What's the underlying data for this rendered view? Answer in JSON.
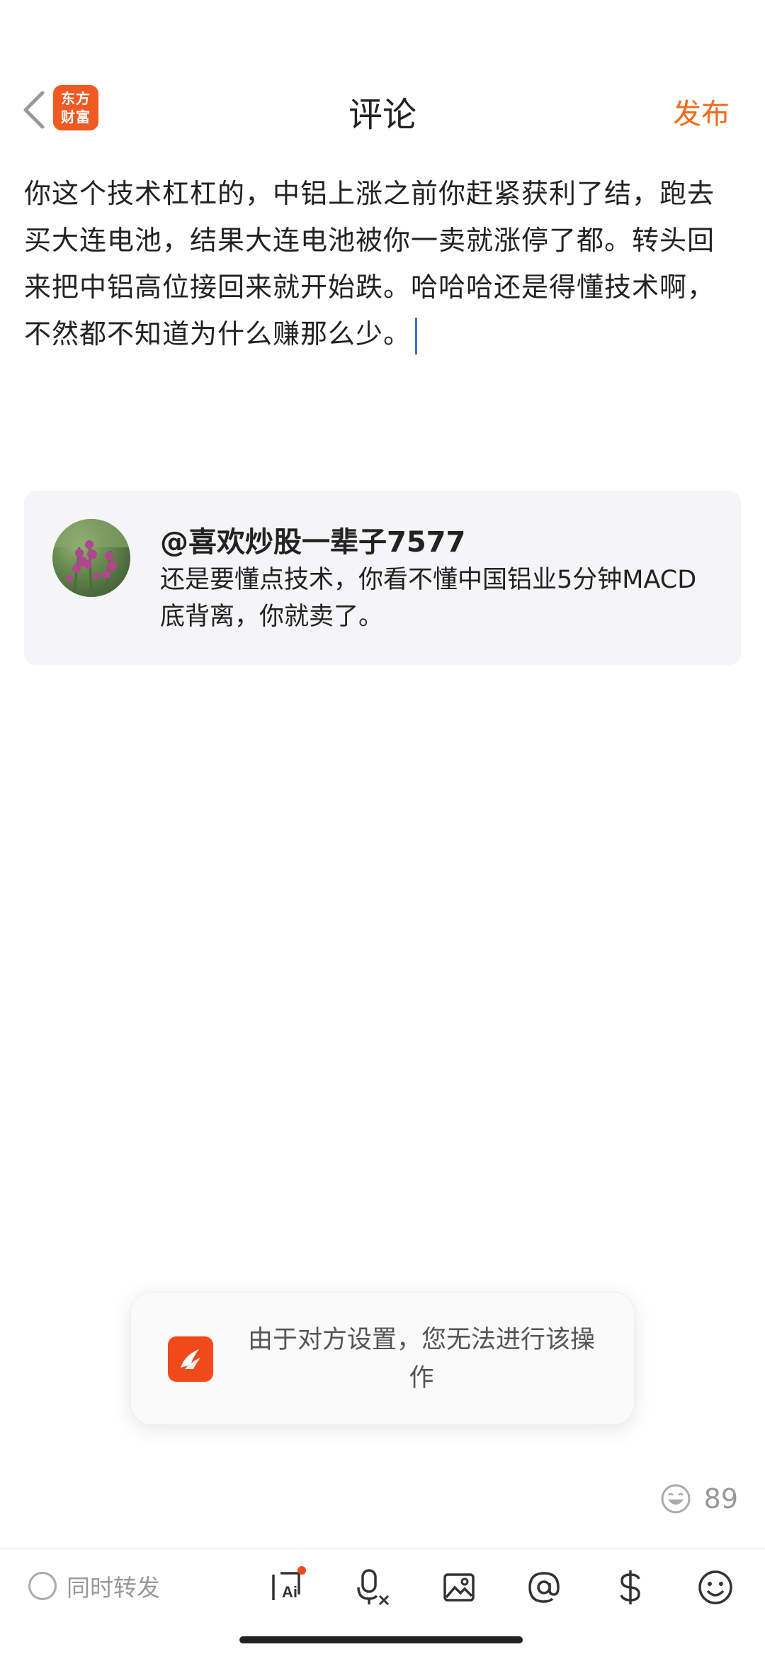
{
  "header": {
    "title": "评论",
    "publish_label": "发布",
    "logo_line1": "东方",
    "logo_line2": "财富"
  },
  "editor": {
    "text": "你这个技术杠杠的，中铝上涨之前你赶紧获利了结，跑去买大连电池，结果大连电池被你一卖就涨停了都。转头回来把中铝高位接回来就开始跌。哈哈哈还是得懂技术啊，不然都不知道为什么赚那么少。"
  },
  "quote": {
    "user": "@喜欢炒股一辈子7577",
    "text": "还是要懂点技术，你看不懂中国铝业5分钟MACD底背离，你就卖了。"
  },
  "toast": {
    "message": "由于对方设置，您无法进行该操作"
  },
  "emoji_counter": {
    "value": "89"
  },
  "toolbar": {
    "repost_label": "同时转发",
    "icons": [
      "ask-ai-icon",
      "voice-to-text-icon",
      "image-icon",
      "at-icon",
      "dollar-icon",
      "emoji-icon"
    ]
  },
  "colors": {
    "accent": "#f06a1a",
    "brand": "#f05a22",
    "caret": "#3b6fd6",
    "card_bg": "#f5f5f7"
  }
}
